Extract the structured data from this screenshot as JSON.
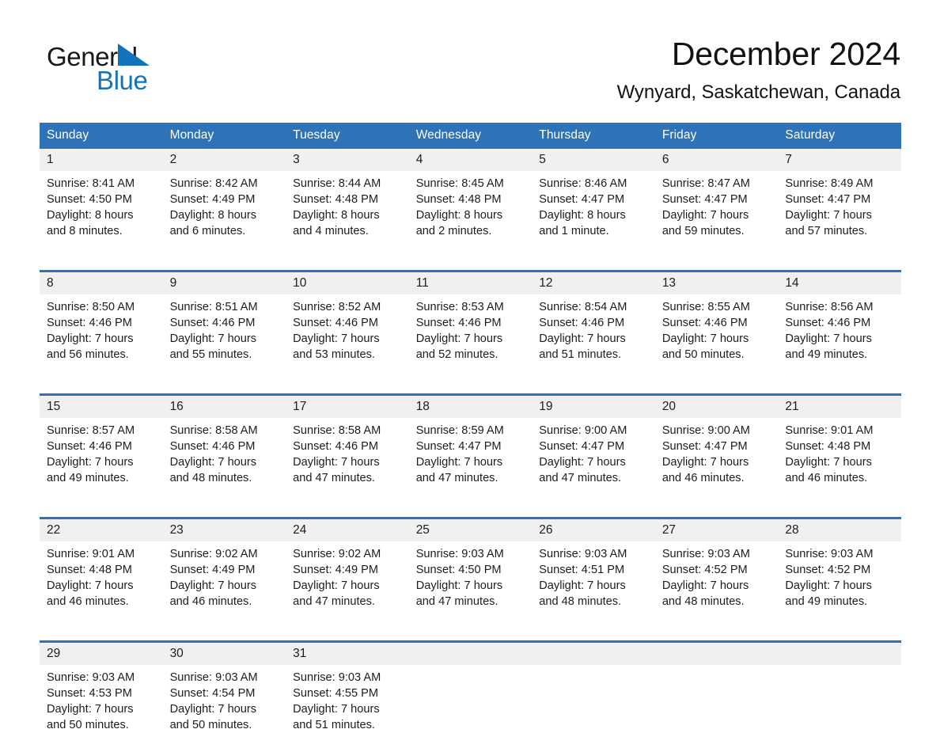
{
  "brand": {
    "name_part1": "General",
    "name_part2": "Blue",
    "accent_color": "#1273ba"
  },
  "header": {
    "title": "December 2024",
    "location": "Wynyard, Saskatchewan, Canada"
  },
  "theme": {
    "header_blue": "#2e72b8",
    "daynum_band": "#f0f0f0"
  },
  "calendar": {
    "weekday_headers": [
      "Sunday",
      "Monday",
      "Tuesday",
      "Wednesday",
      "Thursday",
      "Friday",
      "Saturday"
    ],
    "weeks": [
      [
        {
          "day": "1",
          "sunrise": "Sunrise: 8:41 AM",
          "sunset": "Sunset: 4:50 PM",
          "daylight1": "Daylight: 8 hours",
          "daylight2": "and 8 minutes."
        },
        {
          "day": "2",
          "sunrise": "Sunrise: 8:42 AM",
          "sunset": "Sunset: 4:49 PM",
          "daylight1": "Daylight: 8 hours",
          "daylight2": "and 6 minutes."
        },
        {
          "day": "3",
          "sunrise": "Sunrise: 8:44 AM",
          "sunset": "Sunset: 4:48 PM",
          "daylight1": "Daylight: 8 hours",
          "daylight2": "and 4 minutes."
        },
        {
          "day": "4",
          "sunrise": "Sunrise: 8:45 AM",
          "sunset": "Sunset: 4:48 PM",
          "daylight1": "Daylight: 8 hours",
          "daylight2": "and 2 minutes."
        },
        {
          "day": "5",
          "sunrise": "Sunrise: 8:46 AM",
          "sunset": "Sunset: 4:47 PM",
          "daylight1": "Daylight: 8 hours",
          "daylight2": "and 1 minute."
        },
        {
          "day": "6",
          "sunrise": "Sunrise: 8:47 AM",
          "sunset": "Sunset: 4:47 PM",
          "daylight1": "Daylight: 7 hours",
          "daylight2": "and 59 minutes."
        },
        {
          "day": "7",
          "sunrise": "Sunrise: 8:49 AM",
          "sunset": "Sunset: 4:47 PM",
          "daylight1": "Daylight: 7 hours",
          "daylight2": "and 57 minutes."
        }
      ],
      [
        {
          "day": "8",
          "sunrise": "Sunrise: 8:50 AM",
          "sunset": "Sunset: 4:46 PM",
          "daylight1": "Daylight: 7 hours",
          "daylight2": "and 56 minutes."
        },
        {
          "day": "9",
          "sunrise": "Sunrise: 8:51 AM",
          "sunset": "Sunset: 4:46 PM",
          "daylight1": "Daylight: 7 hours",
          "daylight2": "and 55 minutes."
        },
        {
          "day": "10",
          "sunrise": "Sunrise: 8:52 AM",
          "sunset": "Sunset: 4:46 PM",
          "daylight1": "Daylight: 7 hours",
          "daylight2": "and 53 minutes."
        },
        {
          "day": "11",
          "sunrise": "Sunrise: 8:53 AM",
          "sunset": "Sunset: 4:46 PM",
          "daylight1": "Daylight: 7 hours",
          "daylight2": "and 52 minutes."
        },
        {
          "day": "12",
          "sunrise": "Sunrise: 8:54 AM",
          "sunset": "Sunset: 4:46 PM",
          "daylight1": "Daylight: 7 hours",
          "daylight2": "and 51 minutes."
        },
        {
          "day": "13",
          "sunrise": "Sunrise: 8:55 AM",
          "sunset": "Sunset: 4:46 PM",
          "daylight1": "Daylight: 7 hours",
          "daylight2": "and 50 minutes."
        },
        {
          "day": "14",
          "sunrise": "Sunrise: 8:56 AM",
          "sunset": "Sunset: 4:46 PM",
          "daylight1": "Daylight: 7 hours",
          "daylight2": "and 49 minutes."
        }
      ],
      [
        {
          "day": "15",
          "sunrise": "Sunrise: 8:57 AM",
          "sunset": "Sunset: 4:46 PM",
          "daylight1": "Daylight: 7 hours",
          "daylight2": "and 49 minutes."
        },
        {
          "day": "16",
          "sunrise": "Sunrise: 8:58 AM",
          "sunset": "Sunset: 4:46 PM",
          "daylight1": "Daylight: 7 hours",
          "daylight2": "and 48 minutes."
        },
        {
          "day": "17",
          "sunrise": "Sunrise: 8:58 AM",
          "sunset": "Sunset: 4:46 PM",
          "daylight1": "Daylight: 7 hours",
          "daylight2": "and 47 minutes."
        },
        {
          "day": "18",
          "sunrise": "Sunrise: 8:59 AM",
          "sunset": "Sunset: 4:47 PM",
          "daylight1": "Daylight: 7 hours",
          "daylight2": "and 47 minutes."
        },
        {
          "day": "19",
          "sunrise": "Sunrise: 9:00 AM",
          "sunset": "Sunset: 4:47 PM",
          "daylight1": "Daylight: 7 hours",
          "daylight2": "and 47 minutes."
        },
        {
          "day": "20",
          "sunrise": "Sunrise: 9:00 AM",
          "sunset": "Sunset: 4:47 PM",
          "daylight1": "Daylight: 7 hours",
          "daylight2": "and 46 minutes."
        },
        {
          "day": "21",
          "sunrise": "Sunrise: 9:01 AM",
          "sunset": "Sunset: 4:48 PM",
          "daylight1": "Daylight: 7 hours",
          "daylight2": "and 46 minutes."
        }
      ],
      [
        {
          "day": "22",
          "sunrise": "Sunrise: 9:01 AM",
          "sunset": "Sunset: 4:48 PM",
          "daylight1": "Daylight: 7 hours",
          "daylight2": "and 46 minutes."
        },
        {
          "day": "23",
          "sunrise": "Sunrise: 9:02 AM",
          "sunset": "Sunset: 4:49 PM",
          "daylight1": "Daylight: 7 hours",
          "daylight2": "and 46 minutes."
        },
        {
          "day": "24",
          "sunrise": "Sunrise: 9:02 AM",
          "sunset": "Sunset: 4:49 PM",
          "daylight1": "Daylight: 7 hours",
          "daylight2": "and 47 minutes."
        },
        {
          "day": "25",
          "sunrise": "Sunrise: 9:03 AM",
          "sunset": "Sunset: 4:50 PM",
          "daylight1": "Daylight: 7 hours",
          "daylight2": "and 47 minutes."
        },
        {
          "day": "26",
          "sunrise": "Sunrise: 9:03 AM",
          "sunset": "Sunset: 4:51 PM",
          "daylight1": "Daylight: 7 hours",
          "daylight2": "and 48 minutes."
        },
        {
          "day": "27",
          "sunrise": "Sunrise: 9:03 AM",
          "sunset": "Sunset: 4:52 PM",
          "daylight1": "Daylight: 7 hours",
          "daylight2": "and 48 minutes."
        },
        {
          "day": "28",
          "sunrise": "Sunrise: 9:03 AM",
          "sunset": "Sunset: 4:52 PM",
          "daylight1": "Daylight: 7 hours",
          "daylight2": "and 49 minutes."
        }
      ],
      [
        {
          "day": "29",
          "sunrise": "Sunrise: 9:03 AM",
          "sunset": "Sunset: 4:53 PM",
          "daylight1": "Daylight: 7 hours",
          "daylight2": "and 50 minutes."
        },
        {
          "day": "30",
          "sunrise": "Sunrise: 9:03 AM",
          "sunset": "Sunset: 4:54 PM",
          "daylight1": "Daylight: 7 hours",
          "daylight2": "and 50 minutes."
        },
        {
          "day": "31",
          "sunrise": "Sunrise: 9:03 AM",
          "sunset": "Sunset: 4:55 PM",
          "daylight1": "Daylight: 7 hours",
          "daylight2": "and 51 minutes."
        },
        {
          "day": "",
          "sunrise": "",
          "sunset": "",
          "daylight1": "",
          "daylight2": ""
        },
        {
          "day": "",
          "sunrise": "",
          "sunset": "",
          "daylight1": "",
          "daylight2": ""
        },
        {
          "day": "",
          "sunrise": "",
          "sunset": "",
          "daylight1": "",
          "daylight2": ""
        },
        {
          "day": "",
          "sunrise": "",
          "sunset": "",
          "daylight1": "",
          "daylight2": ""
        }
      ]
    ]
  }
}
